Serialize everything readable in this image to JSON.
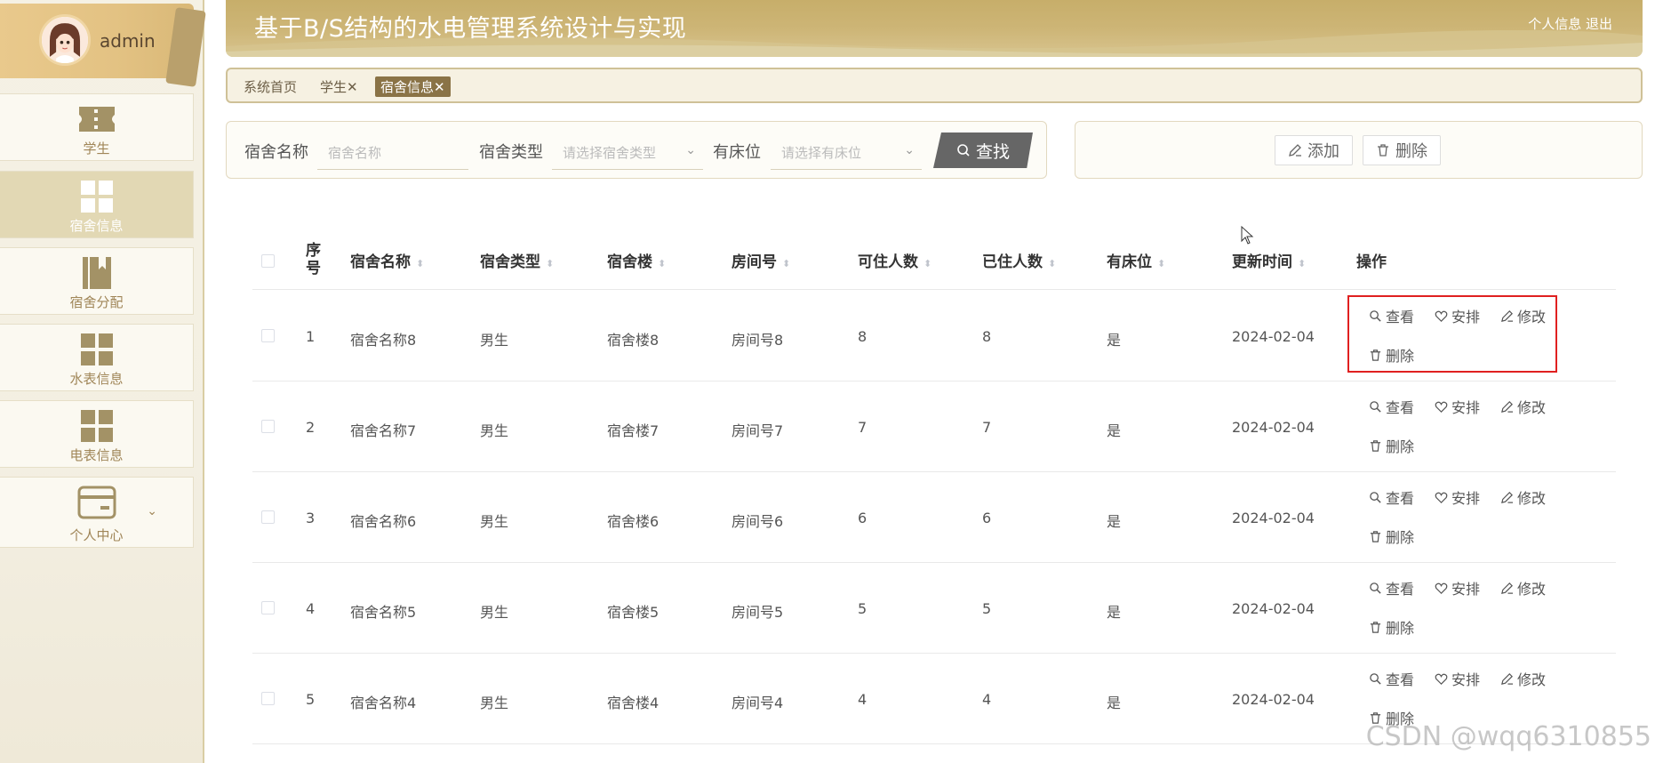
{
  "user": {
    "name": "admin"
  },
  "sidebar": {
    "items": [
      {
        "label": "学生",
        "icon": "ticket-icon",
        "active": false
      },
      {
        "label": "宿舍信息",
        "icon": "grid-icon",
        "active": true
      },
      {
        "label": "宿舍分配",
        "icon": "book-icon",
        "active": false
      },
      {
        "label": "水表信息",
        "icon": "grid-icon",
        "active": false
      },
      {
        "label": "电表信息",
        "icon": "grid-icon",
        "active": false
      },
      {
        "label": "个人中心",
        "icon": "card-icon",
        "active": false,
        "expandable": true
      }
    ]
  },
  "header": {
    "title": "基于B/S结构的水电管理系统设计与实现",
    "personal_info": "个人信息",
    "logout": "退出"
  },
  "tabs": [
    {
      "label": "系统首页",
      "closable": false,
      "active": false
    },
    {
      "label": "学生",
      "closable": true,
      "active": false
    },
    {
      "label": "宿舍信息",
      "closable": true,
      "active": true
    }
  ],
  "search": {
    "name_label": "宿舍名称",
    "name_placeholder": "宿舍名称",
    "type_label": "宿舍类型",
    "type_placeholder": "请选择宿舍类型",
    "bed_label": "有床位",
    "bed_placeholder": "请选择有床位",
    "search_button": "查找"
  },
  "actions": {
    "add": "添加",
    "delete": "删除"
  },
  "table": {
    "columns": [
      "序号",
      "宿舍名称",
      "宿舍类型",
      "宿舍楼",
      "房间号",
      "可住人数",
      "已住人数",
      "有床位",
      "更新时间",
      "操作"
    ],
    "index_col_line1": "序",
    "index_col_line2": "号",
    "rows": [
      {
        "index": "1",
        "name": "宿舍名称8",
        "type": "男生",
        "building": "宿舍楼8",
        "room": "房间号8",
        "capacity": "8",
        "occupied": "8",
        "has_bed": "是",
        "updated": "2024-02-04"
      },
      {
        "index": "2",
        "name": "宿舍名称7",
        "type": "男生",
        "building": "宿舍楼7",
        "room": "房间号7",
        "capacity": "7",
        "occupied": "7",
        "has_bed": "是",
        "updated": "2024-02-04"
      },
      {
        "index": "3",
        "name": "宿舍名称6",
        "type": "男生",
        "building": "宿舍楼6",
        "room": "房间号6",
        "capacity": "6",
        "occupied": "6",
        "has_bed": "是",
        "updated": "2024-02-04"
      },
      {
        "index": "4",
        "name": "宿舍名称5",
        "type": "男生",
        "building": "宿舍楼5",
        "room": "房间号5",
        "capacity": "5",
        "occupied": "5",
        "has_bed": "是",
        "updated": "2024-02-04"
      },
      {
        "index": "5",
        "name": "宿舍名称4",
        "type": "男生",
        "building": "宿舍楼4",
        "room": "房间号4",
        "capacity": "4",
        "occupied": "4",
        "has_bed": "是",
        "updated": "2024-02-04"
      }
    ],
    "row_ops": {
      "view": "查看",
      "arrange": "安排",
      "edit": "修改",
      "delete": "删除"
    }
  },
  "watermark": "CSDN @wqq6310855",
  "colors": {
    "accent": "#c7ae6a",
    "active_tab": "#8a7346",
    "highlight": "#e02020"
  }
}
